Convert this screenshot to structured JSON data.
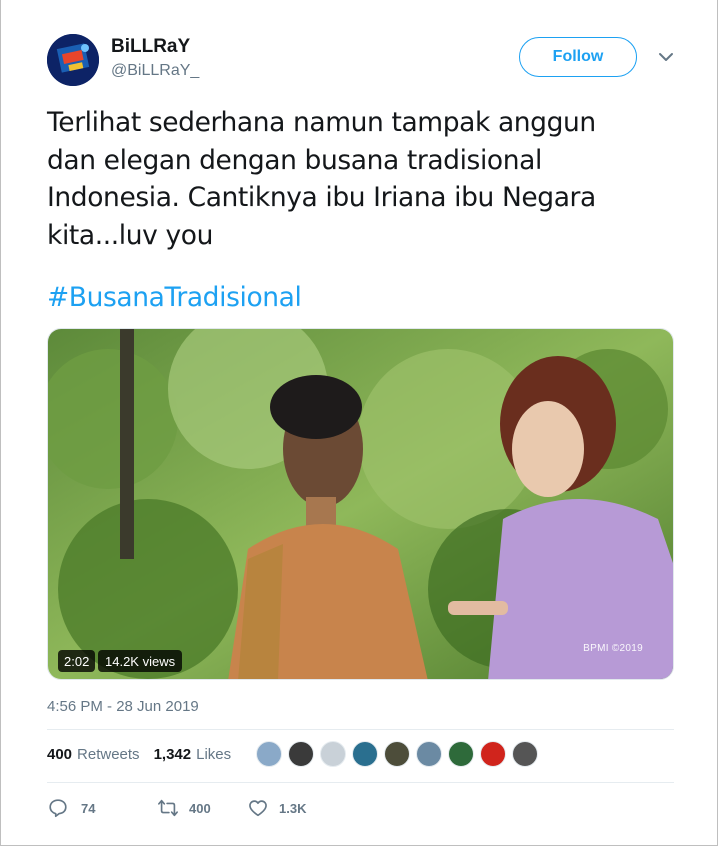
{
  "tweet": {
    "author": {
      "display_name": "BiLLRaY",
      "handle": "@BiLLRaY_",
      "avatar_icon": "avatar-image"
    },
    "follow_label": "Follow",
    "text_lines": [
      "Terlihat sederhana namun tampak anggun",
      "dan elegan dengan busana tradisional",
      "Indonesia. Cantiknya ibu Iriana ibu Negara",
      "kita...luv you"
    ],
    "hashtag": "#BusanaTradisional",
    "media": {
      "duration": "2:02",
      "views": "14.2K views",
      "watermark": "BPMI ©2019"
    },
    "timestamp": "4:56 PM - 28 Jun 2019",
    "stats": {
      "retweets_count": "400",
      "retweets_label": "Retweets",
      "likes_count": "1,342",
      "likes_label": "Likes"
    },
    "actions": {
      "reply_count": "74",
      "retweet_count": "400",
      "like_count": "1.3K"
    }
  },
  "colors": {
    "accent": "#1da1f2",
    "text": "#14171a",
    "secondary": "#657786",
    "divider": "#e6ecf0"
  }
}
